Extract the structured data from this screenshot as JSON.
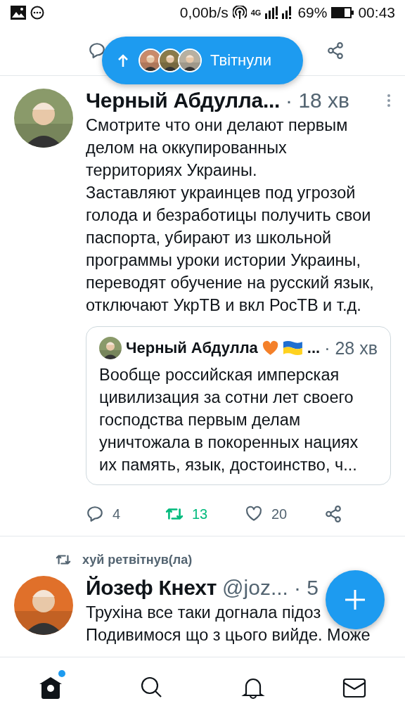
{
  "status_bar": {
    "speed": "0,00b/s",
    "network": "4G",
    "battery": "69%",
    "time": "00:43"
  },
  "new_tweets_pill": {
    "label": "Твітнули"
  },
  "tweets": [
    {
      "author": "Черный Абдулла...",
      "time": "· 18 хв",
      "text_lines": [
        "Смотрите что они делают первым делом на оккупированных территориях Украины.\nЗаставляют украинцев под угрозой голода и безработицы получить свои паспорта, убирают из школьной программы уроки истории Украины, переводят обучение на русский язык, отключают УкрТВ и вкл РосТВ и т.д."
      ],
      "quote": {
        "author": "Черный Абдулла",
        "suffix": "...",
        "time": "· 28 хв",
        "text": "Вообще российская имперская цивилизация за сотни лет своего господства первым делам уничтожала в покоренных нациях их память, язык,  достоинство, ч..."
      },
      "actions": [
        {
          "kind": "reply",
          "count": "4",
          "active": false
        },
        {
          "kind": "retweet",
          "count": "13",
          "active": true
        },
        {
          "kind": "like",
          "count": "20",
          "active": false
        },
        {
          "kind": "share",
          "active": false
        }
      ]
    },
    {
      "author": "Йозеф Кнехт",
      "handle": "@joz...",
      "time": "· 5",
      "retweeted_by": "хуй ретвітнув(ла)",
      "text_lines": [
        "Трухіна все таки догнала підоз",
        "Подивимося що з цього вийде. Може"
      ]
    }
  ],
  "nav": [
    {
      "kind": "home",
      "selected": true,
      "badge": true
    },
    {
      "kind": "search",
      "selected": false,
      "badge": false
    },
    {
      "kind": "notifications",
      "selected": false,
      "badge": false
    },
    {
      "kind": "messages",
      "selected": false,
      "badge": false
    }
  ]
}
